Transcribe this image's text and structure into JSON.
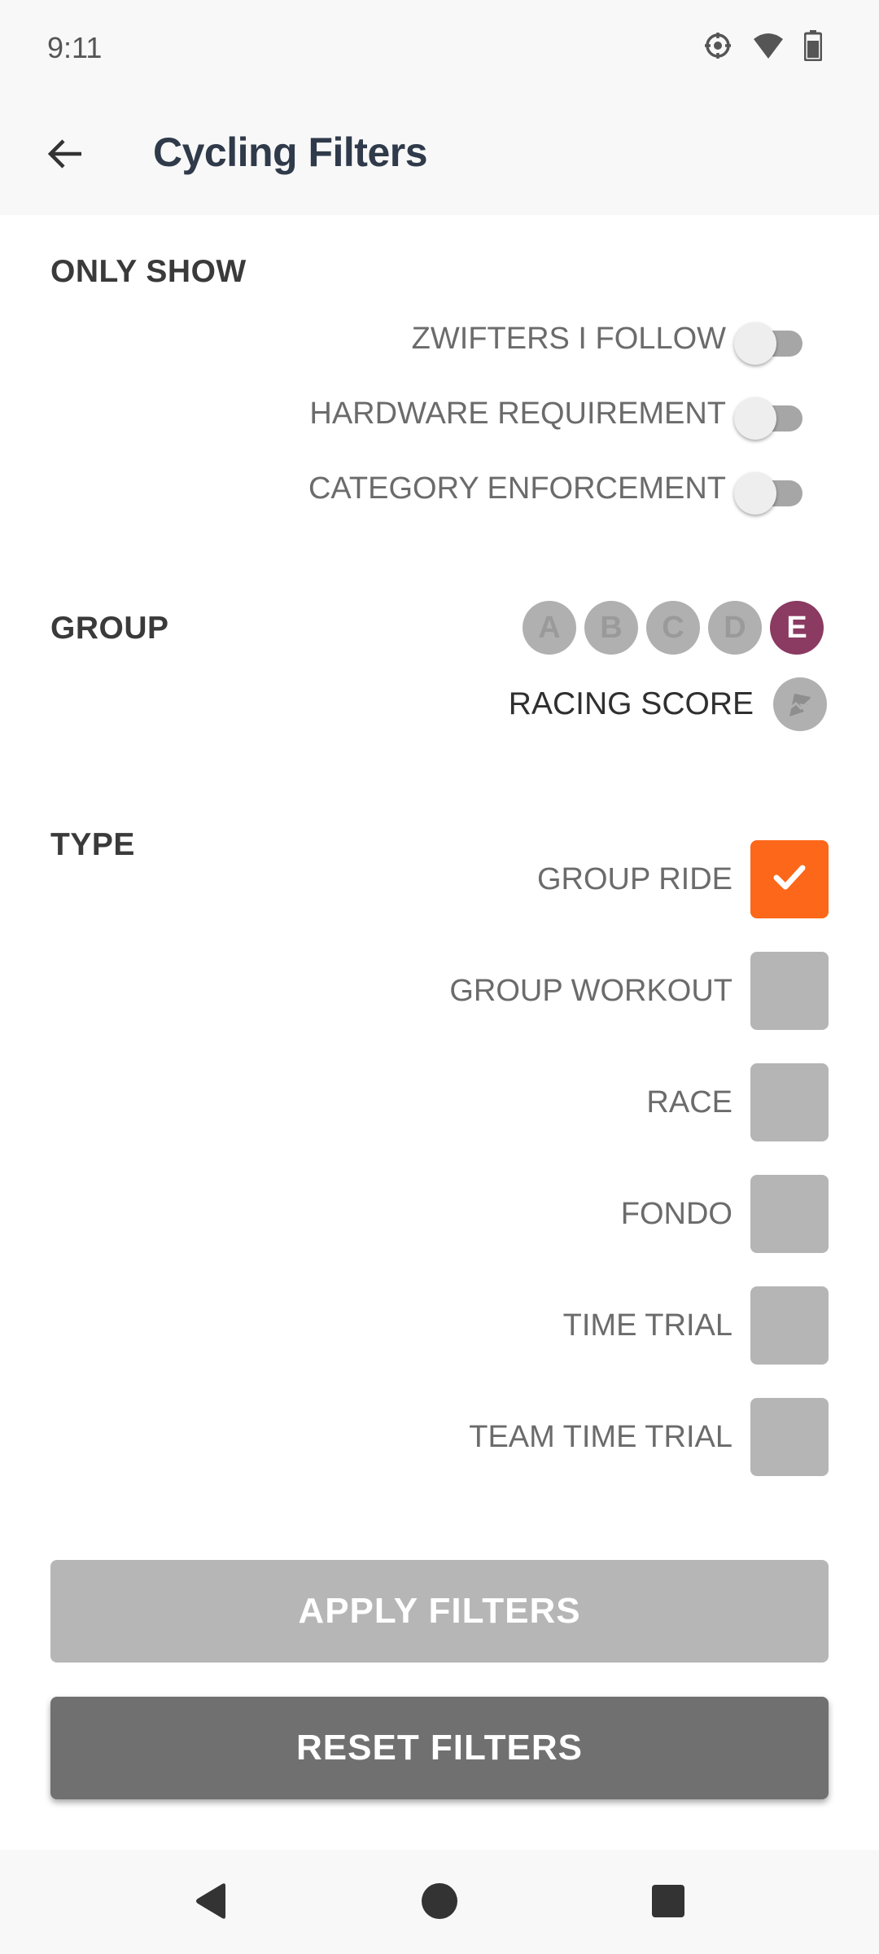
{
  "status": {
    "time": "9:11",
    "icons": [
      "location-icon",
      "wifi-icon",
      "battery-icon"
    ]
  },
  "header": {
    "title": "Cycling Filters",
    "back_icon": "arrow-left-icon"
  },
  "only_show": {
    "title": "ONLY SHOW",
    "toggles": [
      {
        "label": "ZWIFTERS I FOLLOW",
        "on": false
      },
      {
        "label": "HARDWARE REQUIREMENT",
        "on": false
      },
      {
        "label": "CATEGORY ENFORCEMENT",
        "on": false
      }
    ]
  },
  "group": {
    "title": "GROUP",
    "badges": [
      {
        "label": "A",
        "selected": false
      },
      {
        "label": "B",
        "selected": false
      },
      {
        "label": "C",
        "selected": false
      },
      {
        "label": "D",
        "selected": false
      },
      {
        "label": "E",
        "selected": true
      }
    ],
    "racing_score_label": "RACING SCORE",
    "racing_score_icon": "racing-score-icon"
  },
  "type": {
    "title": "TYPE",
    "options": [
      {
        "label": "GROUP RIDE",
        "checked": true
      },
      {
        "label": "GROUP WORKOUT",
        "checked": false
      },
      {
        "label": "RACE",
        "checked": false
      },
      {
        "label": "FONDO",
        "checked": false
      },
      {
        "label": "TIME TRIAL",
        "checked": false
      },
      {
        "label": "TEAM TIME TRIAL",
        "checked": false
      }
    ]
  },
  "buttons": {
    "apply": "APPLY FILTERS",
    "reset": "RESET FILTERS"
  },
  "colors": {
    "accent_orange": "#fc6719",
    "group_e": "#8b3a62",
    "title": "#2f3a4a"
  },
  "nav": {
    "back": "nav-back-icon",
    "home": "nav-home-icon",
    "recents": "nav-recents-icon"
  }
}
